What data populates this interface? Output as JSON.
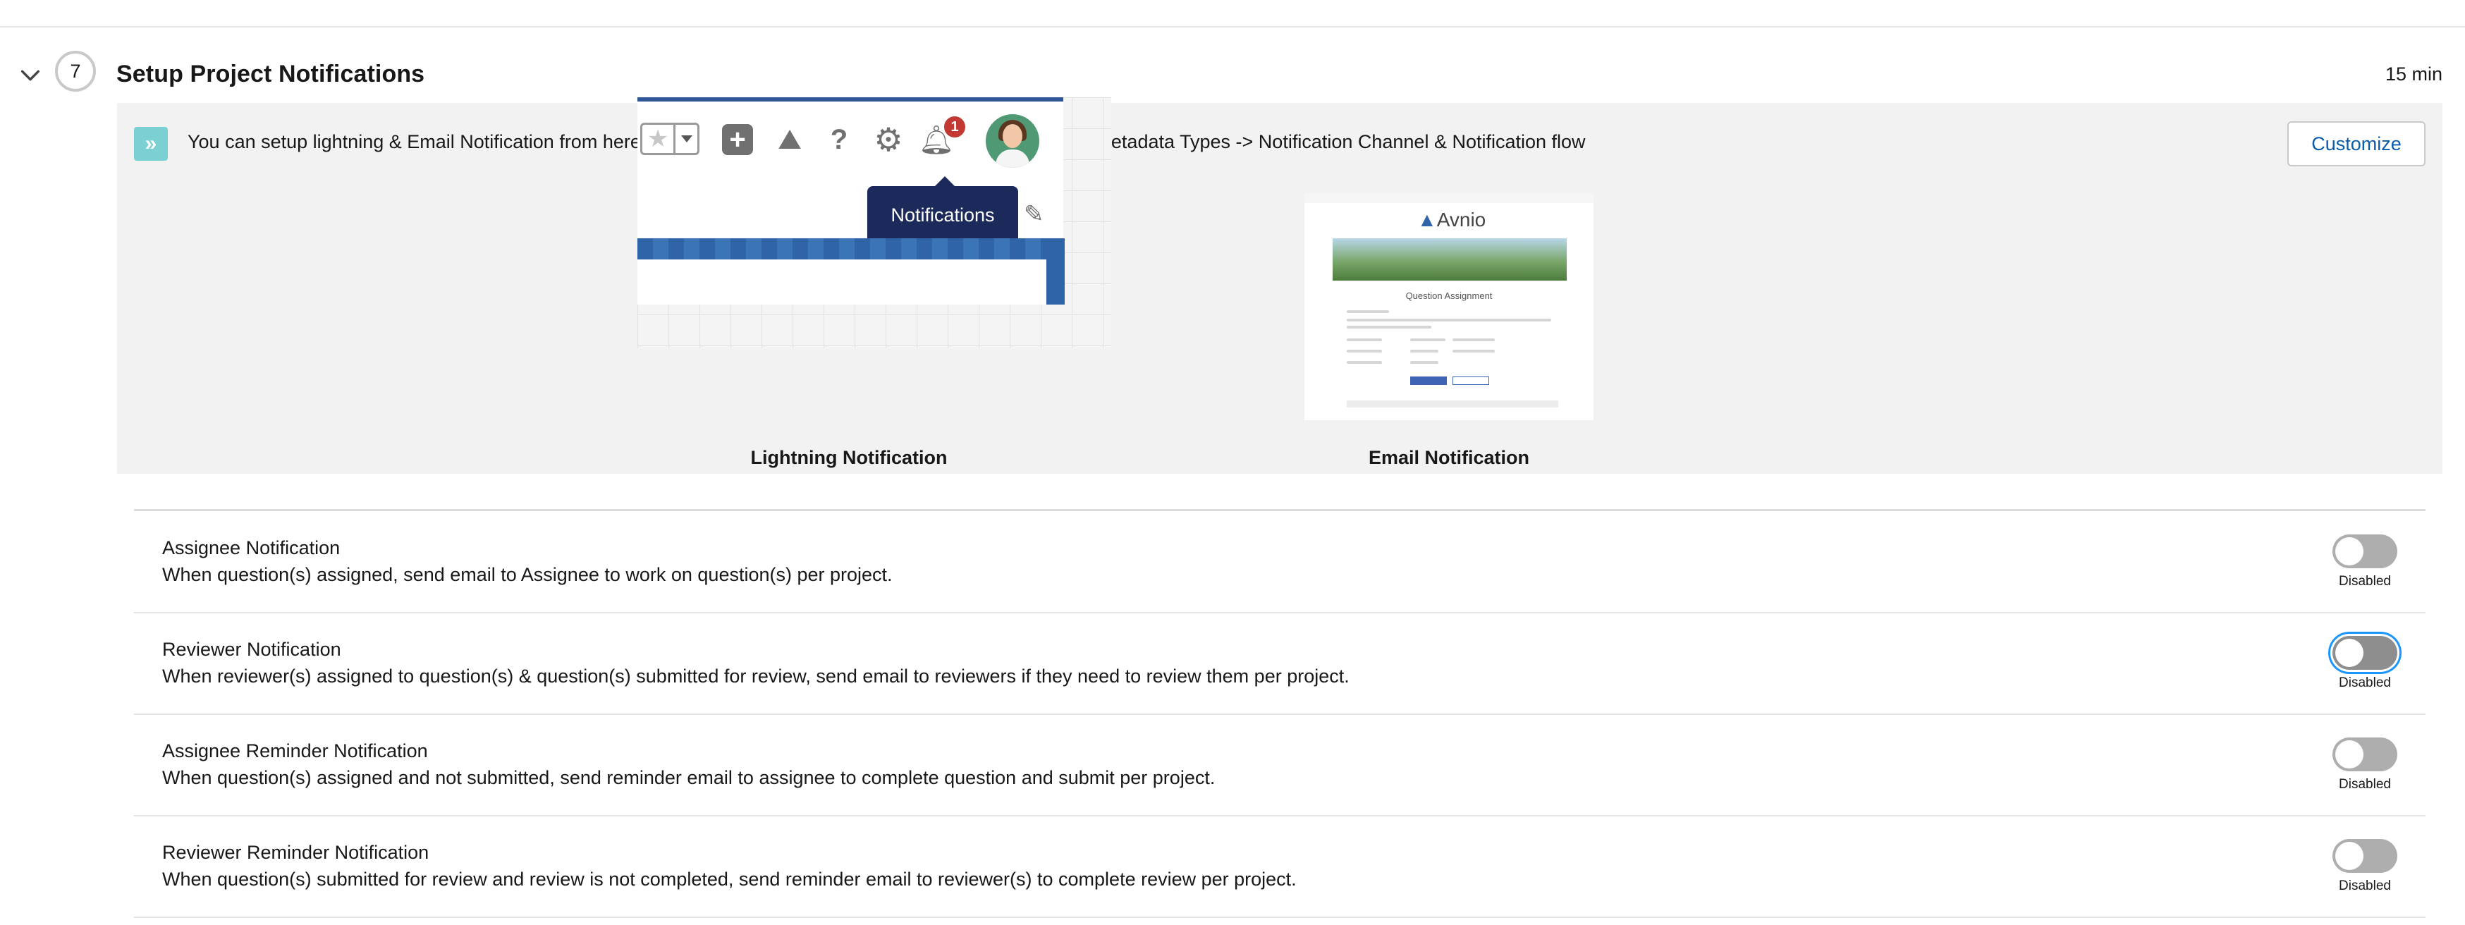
{
  "step": {
    "number": "7",
    "title": "Setup Project Notifications",
    "duration": "15 min"
  },
  "info_panel": {
    "text": "You can setup lightning & Email Notification from here. You can also customize them from Setup -> Custom Metadata Types -> Notification Channel & Notification flow",
    "customize_label": "Customize",
    "icon": "double-chevron-right-icon",
    "icon_color": "#7bd0d4"
  },
  "previews": {
    "lightning": {
      "caption": "Lightning Notification",
      "tooltip": "Notifications",
      "badge_count": "1"
    },
    "email": {
      "caption": "Email Notification",
      "logo_text": "Avnio",
      "heading": "Question Assignment"
    }
  },
  "notifications": [
    {
      "title": "Assignee Notification",
      "description": "When question(s) assigned, send email to Assignee to work on question(s) per project.",
      "status": "Disabled"
    },
    {
      "title": "Reviewer Notification",
      "description": "When reviewer(s) assigned to question(s) & question(s) submitted for review, send email to reviewers if they need to review them per project.",
      "status": "Disabled"
    },
    {
      "title": "Assignee Reminder Notification",
      "description": "When question(s) assigned and not submitted, send reminder email to assignee to complete question and submit per project.",
      "status": "Disabled"
    },
    {
      "title": "Reviewer Reminder Notification",
      "description": "When question(s) submitted for review and review is not completed, send reminder email to reviewer(s) to complete review per project.",
      "status": "Disabled"
    }
  ],
  "colors": {
    "link_blue": "#0b5cab",
    "toggle_off": "#aeaeae",
    "focus_ring": "#1b96ff",
    "panel_bg": "#f2f2f2"
  }
}
